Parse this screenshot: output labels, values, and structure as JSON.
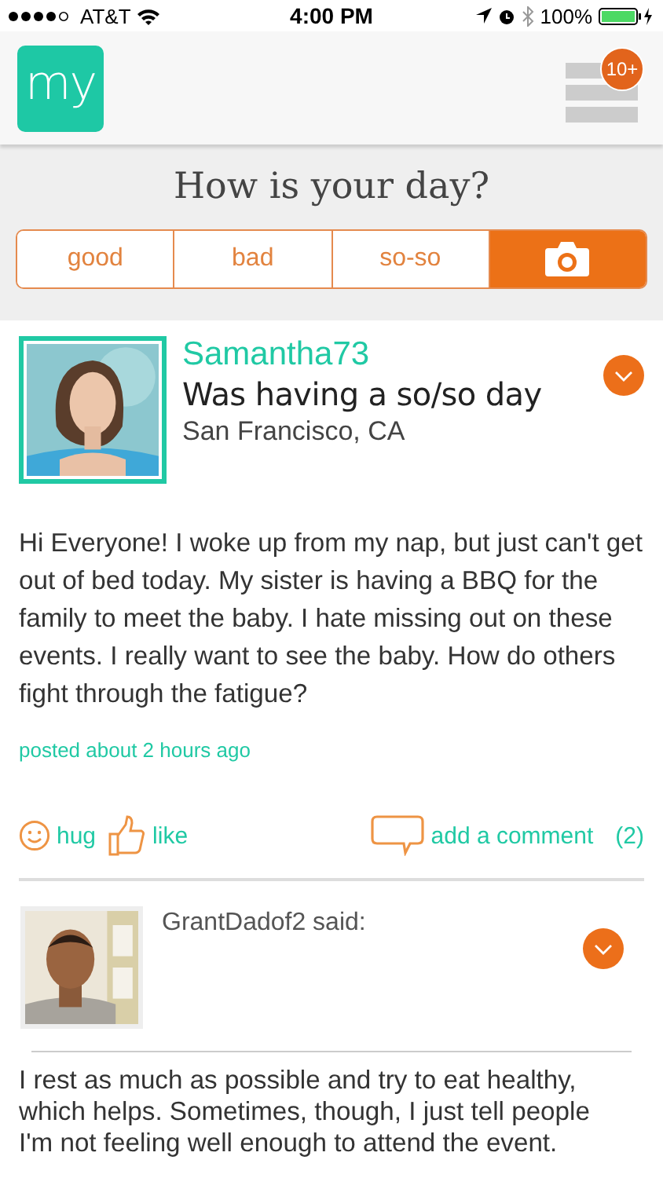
{
  "status_bar": {
    "carrier": "AT&T",
    "time": "4:00 PM",
    "battery": "100%"
  },
  "header": {
    "logo": "my",
    "badge": "10+"
  },
  "mood": {
    "question": "How is your day?",
    "options": [
      {
        "kind": "text",
        "label": "good"
      },
      {
        "kind": "text",
        "label": "bad"
      },
      {
        "kind": "text",
        "label": "so-so"
      },
      {
        "kind": "camera"
      }
    ]
  },
  "post": {
    "author": "Samantha73",
    "mood_line": "Was having a so/so day",
    "location": "San Francisco, CA",
    "body": "Hi Everyone! I woke up from my nap, but just can't get out of bed today. My sister is having a BBQ for the family to meet the baby. I hate missing out on these events. I really want to see the baby. How do others fight through the fatigue?",
    "posted": "posted about 2 hours ago",
    "actions": {
      "hug": "hug",
      "like": "like",
      "comment": "add a comment",
      "comment_count": "(2)"
    }
  },
  "comment": {
    "author_line": "GrantDadof2 said:",
    "body": "I rest as much as possible and try to eat healthy, which helps. Sometimes, though, I just tell people I'm not feeling well enough to attend the event."
  }
}
